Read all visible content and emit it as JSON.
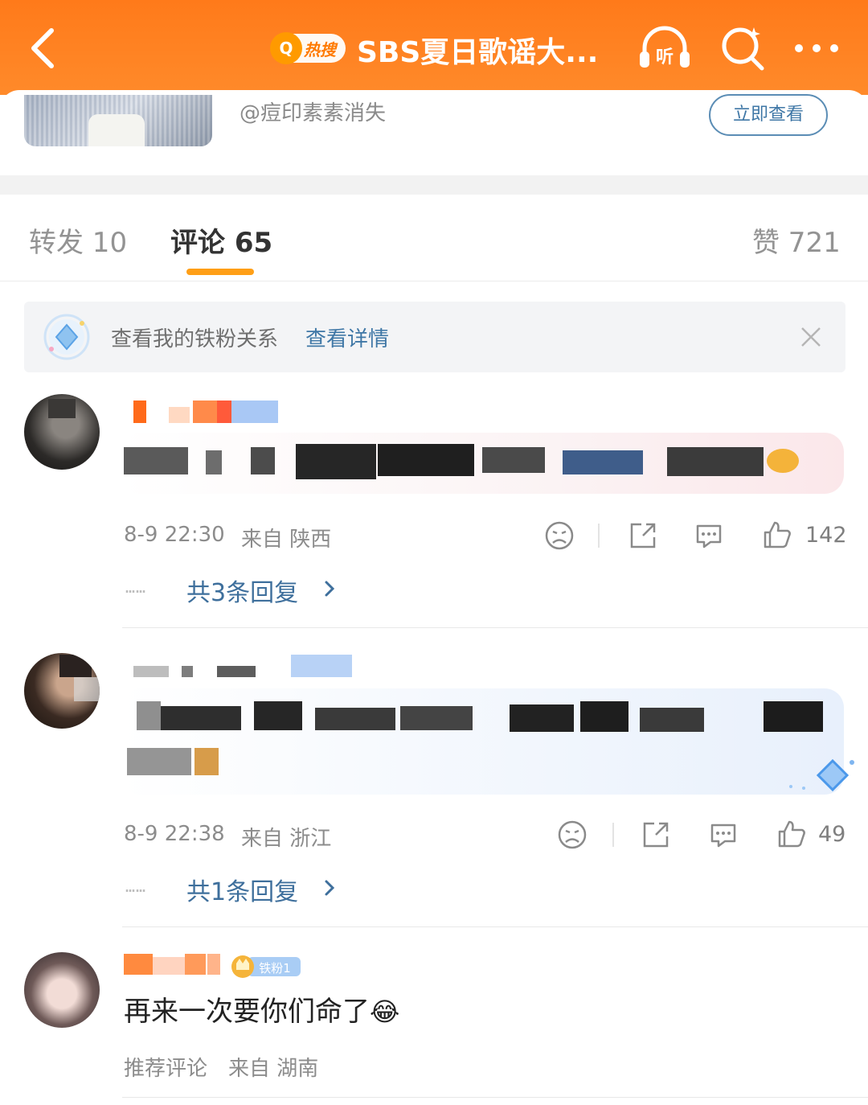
{
  "header": {
    "hot_search_label": "热搜",
    "title": "SBS夏日歌谣大...",
    "listen_label": "听",
    "colors": {
      "bar": "#ff7a1a"
    }
  },
  "post_card": {
    "username": "@痘印素素消失",
    "view_button": "立即查看"
  },
  "tabs": [
    {
      "label": "转发 10"
    },
    {
      "label": "评论 65"
    },
    {
      "label": "赞 721"
    }
  ],
  "fan_banner": {
    "text": "查看我的铁粉关系",
    "link": "查看详情"
  },
  "comments": [
    {
      "time": "8-9 22:30",
      "location": "来自 陕西",
      "likes": "142",
      "replies": "共3条回复",
      "dots": "……"
    },
    {
      "time": "8-9 22:38",
      "location": "来自 浙江",
      "likes": "49",
      "replies": "共1条回复",
      "dots": "……"
    },
    {
      "badge": "铁粉1",
      "text": "再来一次要你们命了",
      "emoji": "😂",
      "meta_label": "推荐评论",
      "location": "来自 湖南"
    }
  ]
}
